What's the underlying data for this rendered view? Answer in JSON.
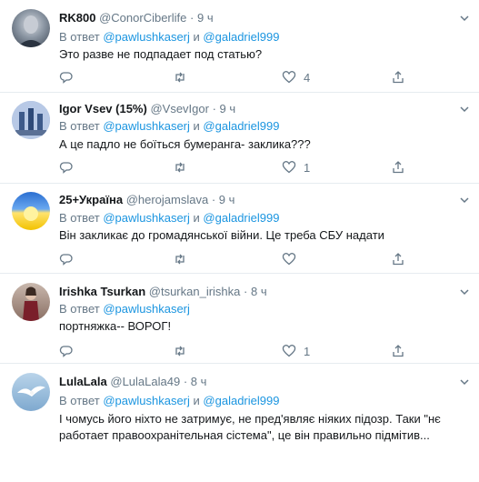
{
  "tweets": [
    {
      "name": "RK800",
      "handle": "@ConorCiberlife",
      "separator": "·",
      "time": "9 ч",
      "reply_prefix": "В ответ",
      "mention1": "@pawlushkaserj",
      "conj": "и",
      "mention2": "@galadriel999",
      "text": "Это разве не подпадает под статью?",
      "likes": "4"
    },
    {
      "name": "Igor Vsev (15%)",
      "handle": "@VsevIgor",
      "separator": "·",
      "time": "9 ч",
      "reply_prefix": "В ответ",
      "mention1": "@pawlushkaserj",
      "conj": "и",
      "mention2": "@galadriel999",
      "text": "А це падло не боїться бумеранга- заклика???",
      "likes": "1"
    },
    {
      "name": "25+Україна",
      "handle": "@herojamslava",
      "separator": "·",
      "time": "9 ч",
      "reply_prefix": "В ответ",
      "mention1": "@pawlushkaserj",
      "conj": "и",
      "mention2": "@galadriel999",
      "text": "Він закликає до громадянської війни. Це треба СБУ надати",
      "likes": ""
    },
    {
      "name": "Irishka Tsurkan",
      "handle": "@tsurkan_irishka",
      "separator": "·",
      "time": "8 ч",
      "reply_prefix": "В ответ",
      "mention1": "@pawlushkaserj",
      "text": "портняжка-- ВОРОГ!",
      "likes": "1"
    },
    {
      "name": "LulaLala",
      "handle": "@LulaLala49",
      "separator": "·",
      "time": "8 ч",
      "reply_prefix": "В ответ",
      "mention1": "@pawlushkaserj",
      "conj": "и",
      "mention2": "@galadriel999",
      "text_line1": "І чомусь його ніхто не затримує, не пред'являє ніяких підозр. Таки \"нє",
      "text_line2": "работает правоохранітельная сістема\", це він правильно підмітив..."
    }
  ],
  "colors": {
    "link": "#1b95e0",
    "secondary": "#657786",
    "border": "#e6ecf0"
  },
  "icons": [
    "reply-icon",
    "retweet-icon",
    "like-icon",
    "share-icon",
    "caret-down-icon"
  ]
}
